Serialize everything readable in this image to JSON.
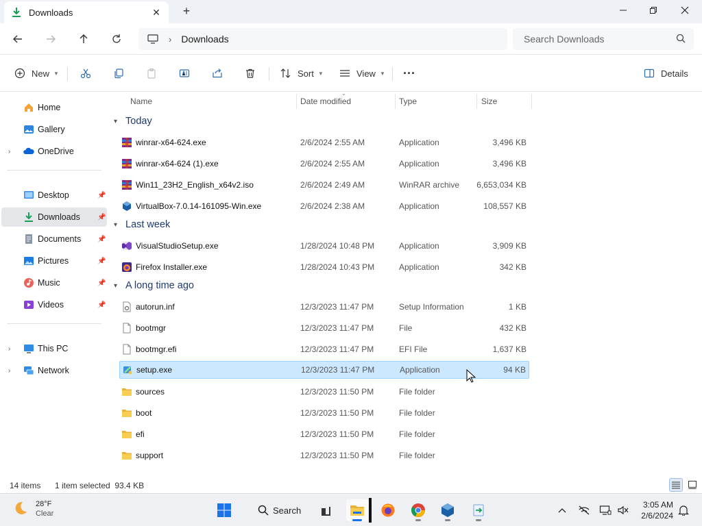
{
  "window": {
    "tab_title": "Downloads",
    "colors": {
      "accent": "#1a73e8",
      "selection": "#cce8ff",
      "group_header": "#1f3b6e"
    }
  },
  "address": {
    "crumb": "Downloads",
    "search_placeholder": "Search Downloads"
  },
  "toolbar": {
    "new_label": "New",
    "sort_label": "Sort",
    "view_label": "View",
    "details_label": "Details",
    "more_label": "···"
  },
  "sidebar": {
    "items": [
      {
        "label": "Home",
        "icon": "home-icon"
      },
      {
        "label": "Gallery",
        "icon": "gallery-icon"
      },
      {
        "label": "OneDrive",
        "icon": "cloud-icon"
      },
      {
        "label": "Desktop",
        "icon": "desktop-icon"
      },
      {
        "label": "Downloads",
        "icon": "download-icon"
      },
      {
        "label": "Documents",
        "icon": "documents-icon"
      },
      {
        "label": "Pictures",
        "icon": "pictures-icon"
      },
      {
        "label": "Music",
        "icon": "music-icon"
      },
      {
        "label": "Videos",
        "icon": "videos-icon"
      },
      {
        "label": "This PC",
        "icon": "pc-icon"
      },
      {
        "label": "Network",
        "icon": "network-icon"
      }
    ]
  },
  "columns": {
    "name": "Name",
    "date": "Date modified",
    "type": "Type",
    "size": "Size"
  },
  "groups": {
    "today": "Today",
    "last_week": "Last week",
    "long_ago": "A long time ago"
  },
  "files": [
    {
      "name": "winrar-x64-624.exe",
      "date": "2/6/2024 2:55 AM",
      "type": "Application",
      "size": "3,496 KB",
      "icon": "winrar-icon"
    },
    {
      "name": "winrar-x64-624 (1).exe",
      "date": "2/6/2024 2:55 AM",
      "type": "Application",
      "size": "3,496 KB",
      "icon": "winrar-icon"
    },
    {
      "name": "Win11_23H2_English_x64v2.iso",
      "date": "2/6/2024 2:49 AM",
      "type": "WinRAR archive",
      "size": "6,653,034 KB",
      "icon": "winrar-icon"
    },
    {
      "name": "VirtualBox-7.0.14-161095-Win.exe",
      "date": "2/6/2024 2:38 AM",
      "type": "Application",
      "size": "108,557 KB",
      "icon": "virtualbox-icon"
    },
    {
      "name": "VisualStudioSetup.exe",
      "date": "1/28/2024 10:48 PM",
      "type": "Application",
      "size": "3,909 KB",
      "icon": "visualstudio-icon"
    },
    {
      "name": "Firefox Installer.exe",
      "date": "1/28/2024 10:43 PM",
      "type": "Application",
      "size": "342 KB",
      "icon": "firefox-icon"
    },
    {
      "name": "autorun.inf",
      "date": "12/3/2023 11:47 PM",
      "type": "Setup Information",
      "size": "1 KB",
      "icon": "settings-file-icon"
    },
    {
      "name": "bootmgr",
      "date": "12/3/2023 11:47 PM",
      "type": "File",
      "size": "432 KB",
      "icon": "file-icon"
    },
    {
      "name": "bootmgr.efi",
      "date": "12/3/2023 11:47 PM",
      "type": "EFI File",
      "size": "1,637 KB",
      "icon": "file-icon"
    },
    {
      "name": "setup.exe",
      "date": "12/3/2023 11:47 PM",
      "type": "Application",
      "size": "94 KB",
      "icon": "setup-icon"
    },
    {
      "name": "sources",
      "date": "12/3/2023 11:50 PM",
      "type": "File folder",
      "size": "",
      "icon": "folder-icon"
    },
    {
      "name": "boot",
      "date": "12/3/2023 11:50 PM",
      "type": "File folder",
      "size": "",
      "icon": "folder-icon"
    },
    {
      "name": "efi",
      "date": "12/3/2023 11:50 PM",
      "type": "File folder",
      "size": "",
      "icon": "folder-icon"
    },
    {
      "name": "support",
      "date": "12/3/2023 11:50 PM",
      "type": "File folder",
      "size": "",
      "icon": "folder-icon"
    }
  ],
  "status": {
    "item_count": "14 items",
    "selection": "1 item selected  93.4 KB"
  },
  "taskbar": {
    "temp": "28°F",
    "condition": "Clear",
    "search_label": "Search",
    "time": "3:05 AM",
    "date": "2/6/2024"
  }
}
